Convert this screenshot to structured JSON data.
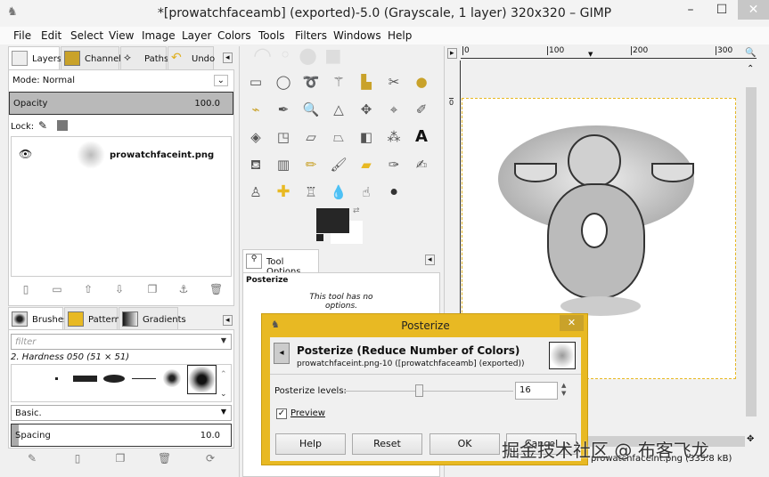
{
  "window": {
    "title": "*[prowatchfaceamb] (exported)-5.0 (Grayscale, 1 layer) 320x320 – GIMP",
    "minimize": "–",
    "maximize": "☐",
    "close": "✕"
  },
  "menu": [
    "File",
    "Edit",
    "Select",
    "View",
    "Image",
    "Layer",
    "Colors",
    "Tools",
    "Filters",
    "Windows",
    "Help"
  ],
  "layers_dock": {
    "tabs": [
      "Layers",
      "Channels",
      "Paths",
      "Undo"
    ],
    "mode_label": "Mode: Normal",
    "opacity_label": "Opacity",
    "opacity_value": "100.0",
    "lock_label": "Lock:",
    "layer_name": "prowatchfaceint.png"
  },
  "brushes_dock": {
    "tabs": [
      "Brushes",
      "Patterns",
      "Gradients"
    ],
    "filter_placeholder": "filter",
    "brush_name": "2. Hardness 050 (51 × 51)",
    "preset": "Basic.",
    "spacing_label": "Spacing",
    "spacing_value": "10.0"
  },
  "tool_options": {
    "tab": "Tool Options",
    "tool_name": "Posterize",
    "message": "This tool has no options."
  },
  "canvas": {
    "ruler_ticks": [
      "0",
      "100",
      "200",
      "300"
    ],
    "vruler_tick": "0",
    "status": "prowatchfaceint.png (335.8 kB)"
  },
  "dialog": {
    "title": "Posterize",
    "heading": "Posterize (Reduce Number of Colors)",
    "subheading": "prowatchfaceint.png-10 ([prowatchfaceamb] (exported))",
    "levels_label": "Posterize levels:",
    "levels_value": "16",
    "levels_min": 1,
    "levels_max": 256,
    "preview_label": "Preview",
    "preview_checked": true,
    "buttons": [
      "Help",
      "Reset",
      "OK",
      "Cancel"
    ],
    "accent": "#e8b923"
  },
  "watermark": "掘金技术社区 @ 布客飞龙"
}
